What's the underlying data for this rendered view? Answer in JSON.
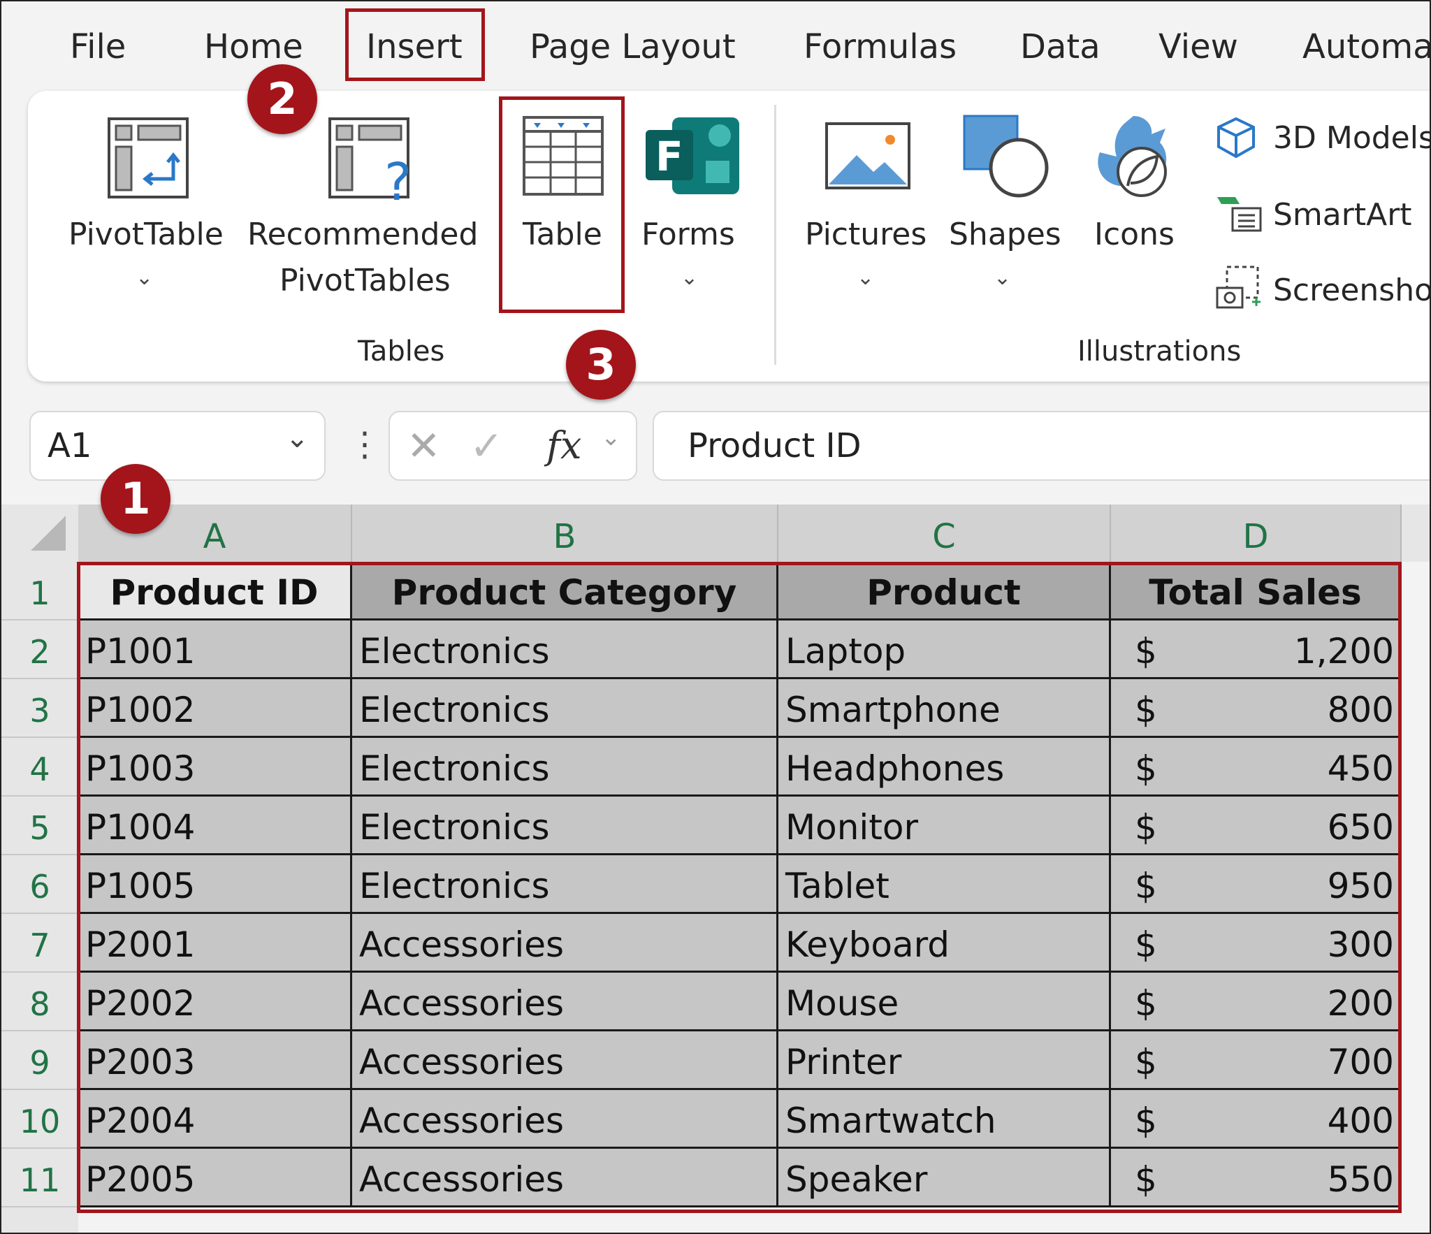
{
  "menu": {
    "tabs": [
      "File",
      "Home",
      "Insert",
      "Page Layout",
      "Formulas",
      "Data",
      "View",
      "Automa"
    ],
    "active": "Insert"
  },
  "ribbon": {
    "tables_group": {
      "label": "Tables",
      "pivot_table": "PivotTable",
      "recommended_line1": "Recommended",
      "recommended_line2": "PivotTables",
      "table": "Table"
    },
    "forms": "Forms",
    "illustrations_group": {
      "label": "Illustrations",
      "pictures": "Pictures",
      "shapes": "Shapes",
      "icons": "Icons",
      "models_3d": "3D Models",
      "smartart": "SmartArt",
      "screenshot": "Screensho"
    }
  },
  "badges": {
    "one": "1",
    "two": "2",
    "three": "3"
  },
  "formula_bar": {
    "name_box": "A1",
    "fx": "fx",
    "content": "Product ID"
  },
  "columns": [
    "A",
    "B",
    "C",
    "D"
  ],
  "rows": [
    "1",
    "2",
    "3",
    "4",
    "5",
    "6",
    "7",
    "8",
    "9",
    "10",
    "11"
  ],
  "table": {
    "headers": [
      "Product ID",
      "Product Category",
      "Product",
      "Total Sales"
    ],
    "currency": "$",
    "data": [
      [
        "P1001",
        "Electronics",
        "Laptop",
        "1,200"
      ],
      [
        "P1002",
        "Electronics",
        "Smartphone",
        "800"
      ],
      [
        "P1003",
        "Electronics",
        "Headphones",
        "450"
      ],
      [
        "P1004",
        "Electronics",
        "Monitor",
        "650"
      ],
      [
        "P1005",
        "Electronics",
        "Tablet",
        "950"
      ],
      [
        "P2001",
        "Accessories",
        "Keyboard",
        "300"
      ],
      [
        "P2002",
        "Accessories",
        "Mouse",
        "200"
      ],
      [
        "P2003",
        "Accessories",
        "Printer",
        "700"
      ],
      [
        "P2004",
        "Accessories",
        "Smartwatch",
        "400"
      ],
      [
        "P2005",
        "Accessories",
        "Speaker",
        "550"
      ]
    ]
  },
  "colors": {
    "highlight": "#a3151b",
    "header_text": "#217346"
  }
}
